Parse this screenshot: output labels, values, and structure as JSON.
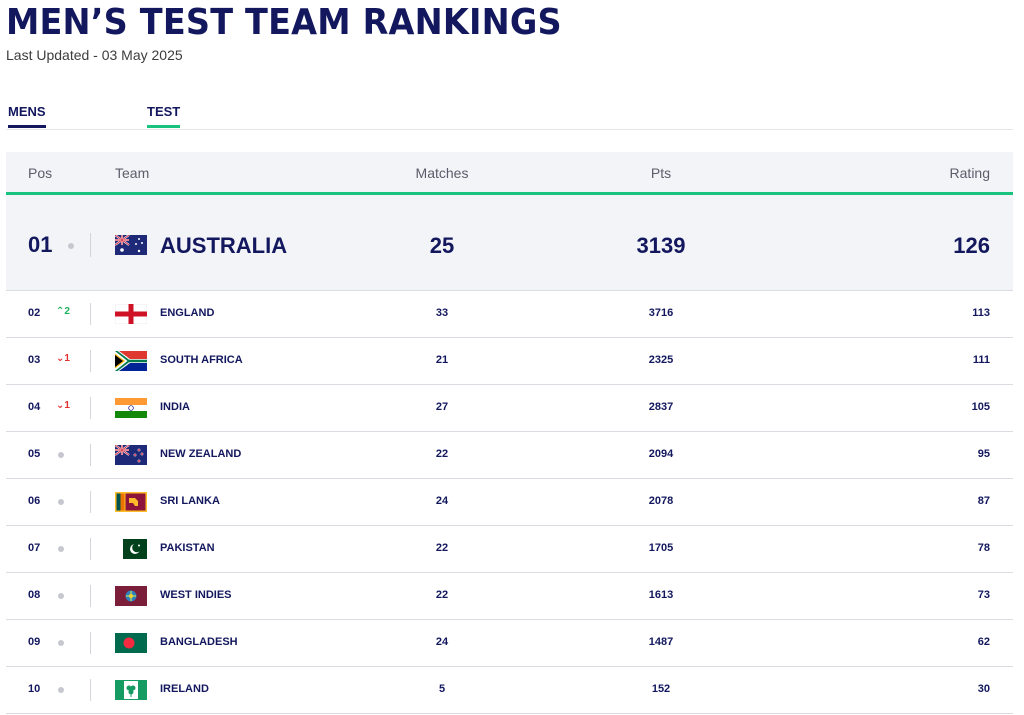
{
  "header": {
    "title": "MEN’S TEST TEAM RANKINGS",
    "updated": "Last Updated - 03 May 2025"
  },
  "tabs": [
    {
      "label": "MENS"
    },
    {
      "label": "TEST"
    }
  ],
  "columns": {
    "pos": "Pos",
    "team": "Team",
    "matches": "Matches",
    "pts": "Pts",
    "rating": "Rating"
  },
  "top_team": {
    "pos": "01",
    "team": "AUSTRALIA",
    "flag": "australia-flag",
    "matches": "25",
    "pts": "3139",
    "rating": "126"
  },
  "rows": [
    {
      "pos": "02",
      "movement": "up",
      "move_text": "^2",
      "team": "ENGLAND",
      "flag": "england-flag",
      "matches": "33",
      "pts": "3716",
      "rating": "113"
    },
    {
      "pos": "03",
      "movement": "down",
      "move_text": "v1",
      "team": "SOUTH AFRICA",
      "flag": "south-africa-flag",
      "matches": "21",
      "pts": "2325",
      "rating": "111"
    },
    {
      "pos": "04",
      "movement": "down",
      "move_text": "v1",
      "team": "INDIA",
      "flag": "india-flag",
      "matches": "27",
      "pts": "2837",
      "rating": "105"
    },
    {
      "pos": "05",
      "movement": "none",
      "team": "NEW ZEALAND",
      "flag": "new-zealand-flag",
      "matches": "22",
      "pts": "2094",
      "rating": "95"
    },
    {
      "pos": "06",
      "movement": "none",
      "team": "SRI LANKA",
      "flag": "sri-lanka-flag",
      "matches": "24",
      "pts": "2078",
      "rating": "87"
    },
    {
      "pos": "07",
      "movement": "none",
      "team": "PAKISTAN",
      "flag": "pakistan-flag",
      "matches": "22",
      "pts": "1705",
      "rating": "78"
    },
    {
      "pos": "08",
      "movement": "none",
      "team": "WEST INDIES",
      "flag": "west-indies-flag",
      "matches": "22",
      "pts": "1613",
      "rating": "73"
    },
    {
      "pos": "09",
      "movement": "none",
      "team": "BANGLADESH",
      "flag": "bangladesh-flag",
      "matches": "24",
      "pts": "1487",
      "rating": "62"
    },
    {
      "pos": "10",
      "movement": "none",
      "team": "IRELAND",
      "flag": "ireland-flag",
      "matches": "5",
      "pts": "152",
      "rating": "30"
    }
  ],
  "colors": {
    "navy": "#12175e",
    "accent_green": "#19c37d",
    "up": "#19b35a",
    "down": "#e0312f",
    "header_bg": "#f3f4f7"
  }
}
